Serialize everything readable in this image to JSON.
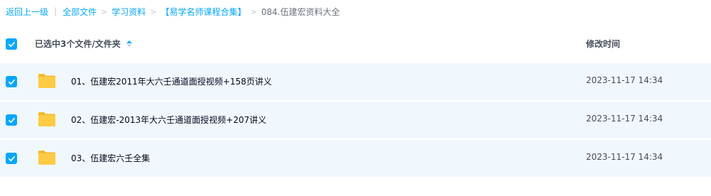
{
  "breadcrumb": {
    "back": "返回上一级",
    "items": [
      "全部文件",
      "学习资料",
      "【易学名师课程合集】"
    ],
    "current": "084.伍建宏资料大全",
    "separator": "|",
    "arrow": ">"
  },
  "header": {
    "selected_label": "已选中3个文件/文件夹",
    "time_label": "修改时间"
  },
  "files": [
    {
      "name": "01、伍建宏2011年大六壬通道面授视频+158页讲义",
      "modified": "2023-11-17 14:34",
      "checked": true
    },
    {
      "name": "02、伍建宏-2013年大六壬通道面授视频+207讲义",
      "modified": "2023-11-17 14:34",
      "checked": true
    },
    {
      "name": "03、伍建宏六壬全集",
      "modified": "2023-11-17 14:34",
      "checked": true
    }
  ],
  "colors": {
    "accent": "#06a7ff",
    "row_selected": "#f0f8fe",
    "folder": "#ffc93c"
  },
  "icons": {
    "folder": "folder-icon",
    "check": "checkmark-icon",
    "sort": "sort-icon"
  }
}
